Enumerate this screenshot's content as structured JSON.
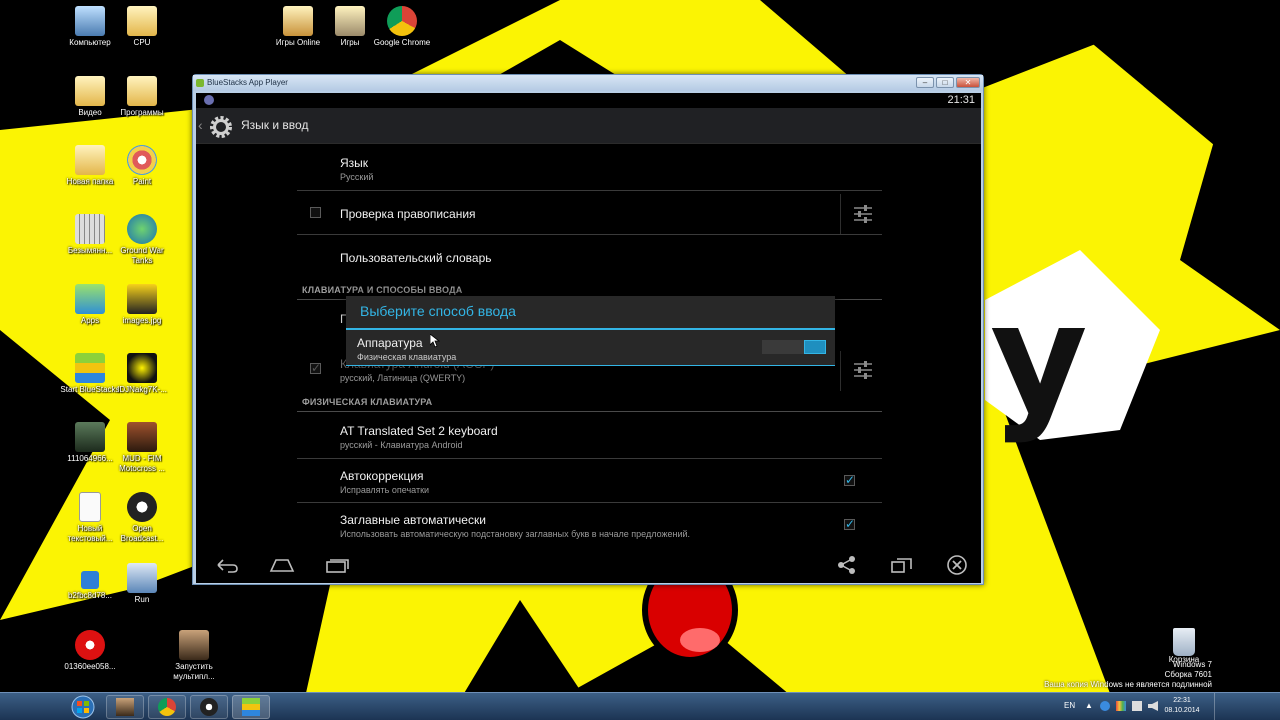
{
  "desktop": {
    "icons": [
      {
        "label": "Компьютер",
        "icon": "computer-icon"
      },
      {
        "label": "CPU",
        "icon": "folder-icon"
      },
      {
        "label": "Игры Online",
        "icon": "folder-icon"
      },
      {
        "label": "Игры",
        "icon": "folder-icon"
      },
      {
        "label": "Google Chrome",
        "icon": "chrome-icon"
      },
      {
        "label": "Видео",
        "icon": "folder-icon"
      },
      {
        "label": "Программы",
        "icon": "folder-icon"
      },
      {
        "label": "Новая папка",
        "icon": "folder-icon"
      },
      {
        "label": "Paint",
        "icon": "paint-icon"
      },
      {
        "label": "Безымянн...",
        "icon": "keyboard-icon"
      },
      {
        "label": "Ground War Tanks",
        "icon": "globe-icon"
      },
      {
        "label": "Apps",
        "icon": "android-icon"
      },
      {
        "label": "images.jpg",
        "icon": "image-icon"
      },
      {
        "label": "Start BlueStacks",
        "icon": "bluestacks-icon"
      },
      {
        "label": "IDJNakg7K-...",
        "icon": "image-icon"
      },
      {
        "label": "111064966...",
        "icon": "image-icon"
      },
      {
        "label": "MUD - FIM Motocross ...",
        "icon": "game-icon"
      },
      {
        "label": "Новый текстовый...",
        "icon": "text-file-icon"
      },
      {
        "label": "Open Broadcast...",
        "icon": "obs-icon"
      },
      {
        "label": "b2fbc8d78...",
        "icon": "image-icon"
      },
      {
        "label": "Run",
        "icon": "run-icon"
      },
      {
        "label": "01360ee058...",
        "icon": "image-icon"
      },
      {
        "label": "Запустить мультипл...",
        "icon": "game-icon"
      }
    ],
    "recycle_bin_label": "Корзина",
    "watermark": {
      "line1": "Windows 7",
      "line2": "Сборка 7601",
      "line3": "Ваша копия Windows не является подлинной"
    }
  },
  "window": {
    "title": "BlueStacks App Player",
    "buttons": {
      "minimize": "–",
      "maximize": "□",
      "close": "✕"
    }
  },
  "android": {
    "status_time": "21:31",
    "actionbar_title": "Язык и ввод",
    "prefs": {
      "language_title": "Язык",
      "language_value": "Русский",
      "spellcheck_title": "Проверка правописания",
      "dictionary_title": "Пользовательский словарь",
      "section_keyboards": "КЛАВИАТУРА И СПОСОБЫ ВВОДА",
      "hidden_pref_title_partial": "П",
      "android_keyboard_title": "Клавиатура Android (AOSP)",
      "android_keyboard_sub": "русский, Латиница (QWERTY)",
      "section_physical": "ФИЗИЧЕСКАЯ КЛАВИАТУРА",
      "at_keyboard_title": "AT Translated Set 2 keyboard",
      "at_keyboard_sub": "русский - Клавиатура Android",
      "autocorrect_title": "Автокоррекция",
      "autocorrect_sub": "Исправлять опечатки",
      "autocaps_title": "Заглавные автоматически",
      "autocaps_sub": "Использовать автоматическую подстановку заглавных букв в начале предложений."
    },
    "dialog": {
      "title": "Выберите способ ввода",
      "item_title": "Аппаратура",
      "item_sub": "Физическая клавиатура",
      "toggle_on": true
    },
    "accent_color": "#33b5e5"
  },
  "taskbar": {
    "lang": "EN",
    "time": "22:31",
    "date": "08.10.2014"
  }
}
